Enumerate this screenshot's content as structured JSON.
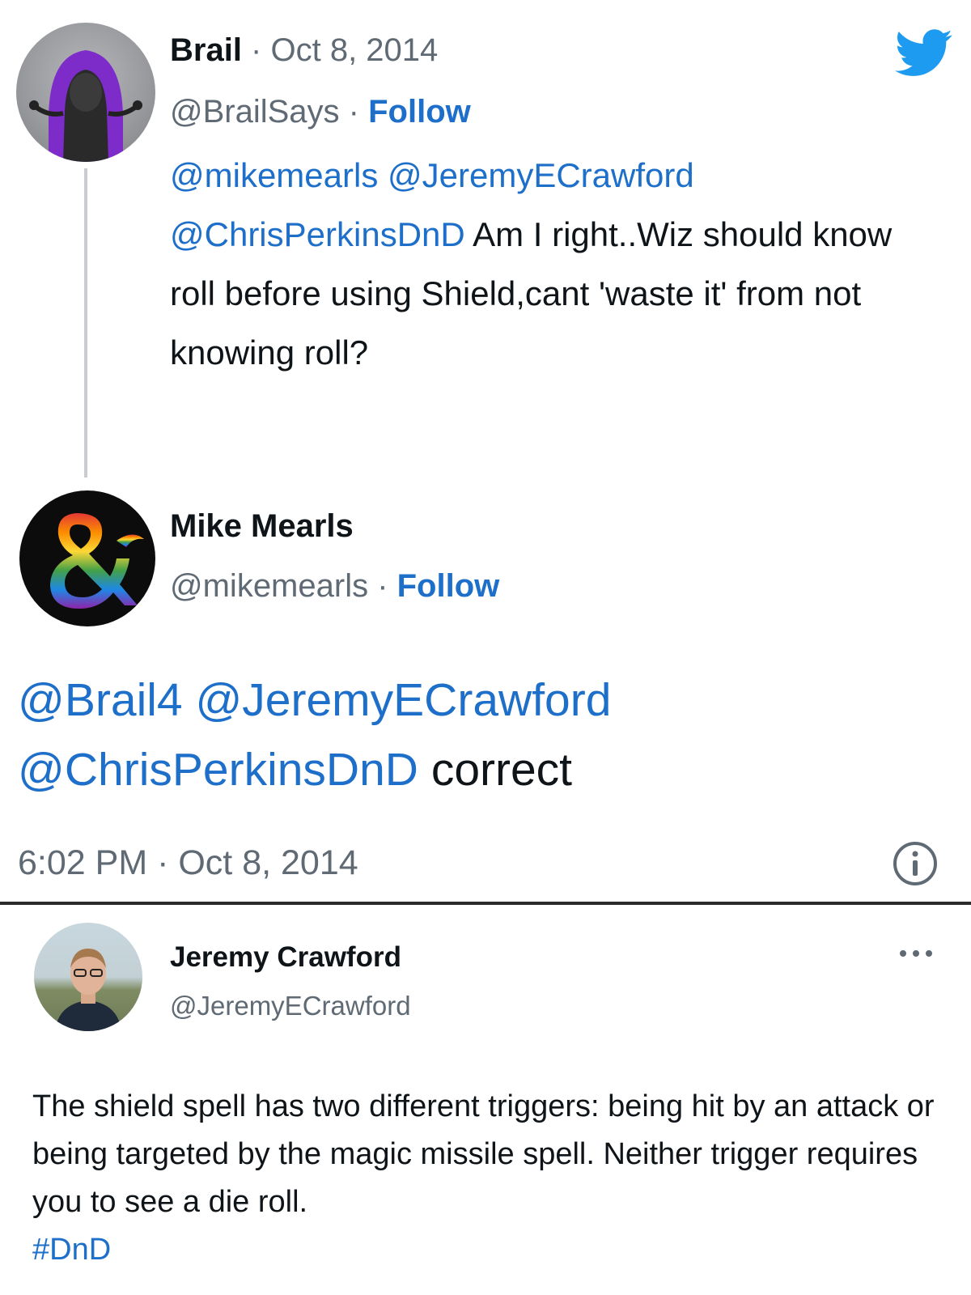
{
  "brail_tweet": {
    "name": "Brail",
    "separator": " · ",
    "date": "Oct 8, 2014",
    "handle": "@BrailSays",
    "follow_separator": " · ",
    "follow_label": "Follow",
    "mentions": [
      "@mikemearls",
      "@JeremyECrawford",
      "@ChrisPerkinsDnD"
    ],
    "text": "Am I right..Wiz should know roll before using Shield,cant 'waste it' from not knowing roll?"
  },
  "reply_tweet": {
    "name": "Mike Mearls",
    "handle": "@mikemearls",
    "follow_separator": " · ",
    "follow_label": "Follow",
    "mentions": [
      "@Brail4",
      "@JeremyECrawford",
      "@ChrisPerkinsDnD"
    ],
    "text": "correct",
    "timestamp": "6:02 PM · Oct 8, 2014"
  },
  "jeremy_tweet": {
    "name": "Jeremy Crawford",
    "handle": "@JeremyECrawford",
    "more_label": "...",
    "text": "The shield spell has two different triggers: being hit by an attack or being targeted by the magic missile spell. Neither trigger requires you to see a die roll.",
    "hashtag": "#DnD"
  },
  "colors": {
    "link": "#1d6fc9",
    "muted": "#5f6a74",
    "twitter_blue": "#1d9bf0"
  },
  "icons": [
    "twitter-bird-icon",
    "info-icon",
    "more-options-icon"
  ]
}
